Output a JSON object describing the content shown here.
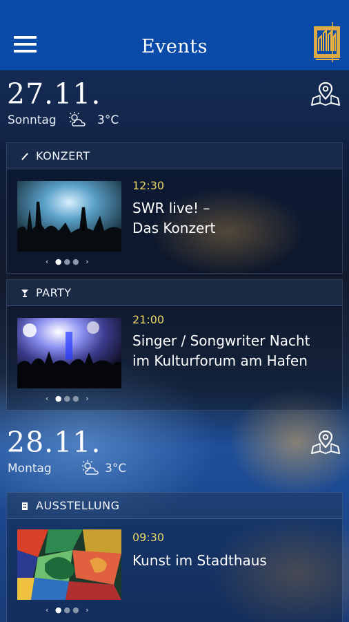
{
  "app": {
    "title": "Events"
  },
  "days": [
    {
      "date": "27.11.",
      "weekday": "Sonntag",
      "temperature": "3°C",
      "weather_icon": "partly-cloudy-icon",
      "events": [
        {
          "category": "KONZERT",
          "category_icon": "pen-icon",
          "time": "12:30",
          "title_line1": "SWR live! –",
          "title_line2": "Das Konzert"
        },
        {
          "category": "PARTY",
          "category_icon": "cocktail-icon",
          "time": "21:00",
          "title_line1": "Singer / Songwriter Nacht",
          "title_line2": "im Kulturforum am Hafen"
        }
      ]
    },
    {
      "date": "28.11.",
      "weekday": "Montag",
      "temperature": "3°C",
      "weather_icon": "partly-cloudy-icon",
      "events": [
        {
          "category": "AUSSTELLUNG",
          "category_icon": "building-icon",
          "time": "09:30",
          "title_line1": "Kunst im Stadthaus",
          "title_line2": ""
        }
      ]
    }
  ],
  "carousel": {
    "prev": "‹",
    "next": "›"
  },
  "colors": {
    "appbar": "#0a4aa8",
    "time": "#e8d567"
  }
}
